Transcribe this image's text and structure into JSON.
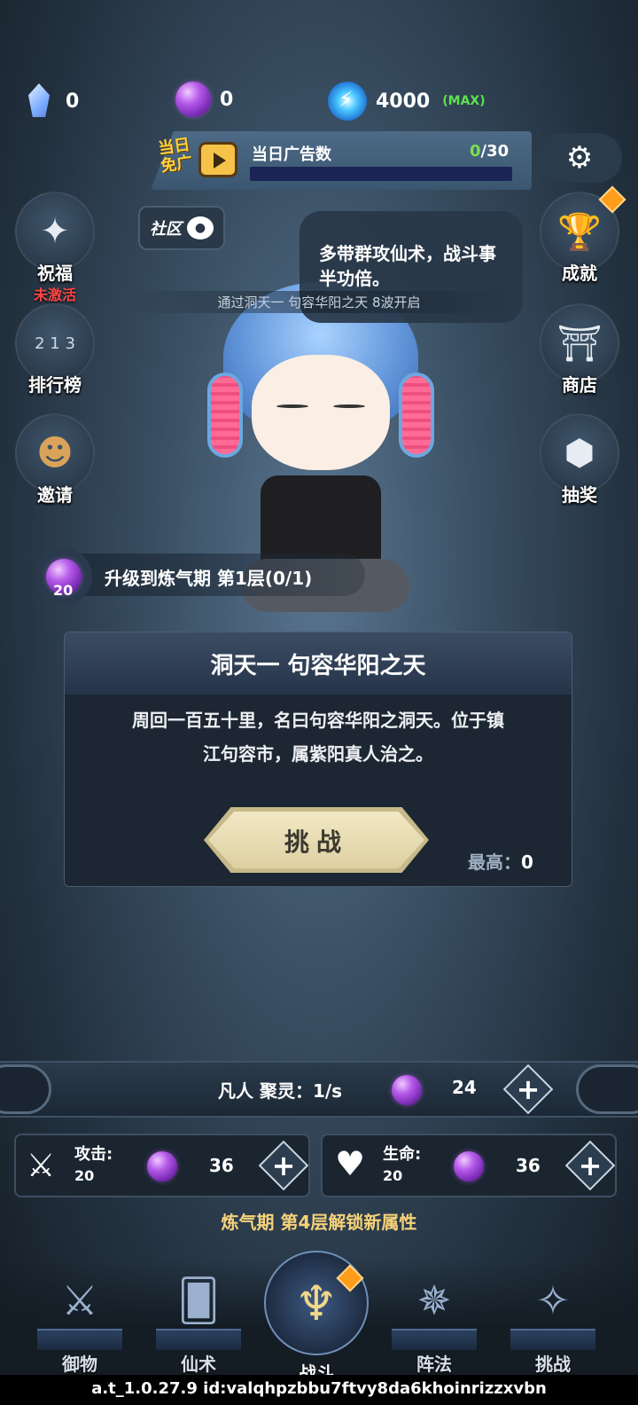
{
  "resources": {
    "crystal": "0",
    "spirit_orb": "0",
    "energy": "4000",
    "energy_max_tag": "(MAX)"
  },
  "ad": {
    "badge_line1": "当日",
    "badge_line2": "免广",
    "label": "当日广告数",
    "current": "0",
    "total": "/30",
    "progress": 0
  },
  "left_buttons": {
    "blessing": {
      "label": "祝福",
      "status": "未激活",
      "icon": "compass-star-icon"
    },
    "ranking": {
      "label": "排行榜",
      "icon": "podium-icon",
      "podium": "2 1 3"
    },
    "invite": {
      "label": "邀请",
      "icon": "add-friend-icon"
    }
  },
  "right_buttons": {
    "achievement": {
      "label": "成就",
      "icon": "trophy-icon"
    },
    "shop": {
      "label": "商店",
      "icon": "shop-icon"
    },
    "lottery": {
      "label": "抽奖",
      "icon": "lottery-icon"
    }
  },
  "community": {
    "label": "社区"
  },
  "speech": "多带群攻仙术，战斗事半功倍。",
  "unlock_hint": "通过洞天一 句容华阳之天 8波开启",
  "upgrade": {
    "orb_count": "20",
    "text": "升级到炼气期 第1层(0/1)"
  },
  "stage": {
    "title": "洞天一 句容华阳之天",
    "desc_line1": "周回一百五十里，名曰句容华阳之洞天。位于镇",
    "desc_line2": "江句容市，属紫阳真人治之。",
    "challenge_label": "挑战",
    "best_label": "最高：",
    "best_value": "0"
  },
  "gather": {
    "text": "凡人 聚灵：1/s",
    "orbs": "24"
  },
  "attributes": {
    "attack": {
      "label": "攻击:",
      "value": "20",
      "cost": "36"
    },
    "life": {
      "label": "生命:",
      "value": "20",
      "cost": "36"
    }
  },
  "unlock_line": "炼气期 第4层解锁新属性",
  "nav": [
    {
      "label": "御物",
      "icon": "flying-swords-icon"
    },
    {
      "label": "仙术",
      "icon": "spell-card-icon"
    },
    {
      "label": "战斗",
      "icon": "battle-trident-icon"
    },
    {
      "label": "阵法",
      "icon": "formation-icon"
    },
    {
      "label": "挑战",
      "icon": "challenge-icon"
    }
  ],
  "version": "a.t_1.0.27.9 id:valqhpzbbu7ftvy8da6khoinrizzxvbn",
  "colors": {
    "accent_green": "#5de24e",
    "warning_red": "#ff4646",
    "gold_text": "#f6d27a",
    "badge_orange": "#ff9c1a"
  }
}
